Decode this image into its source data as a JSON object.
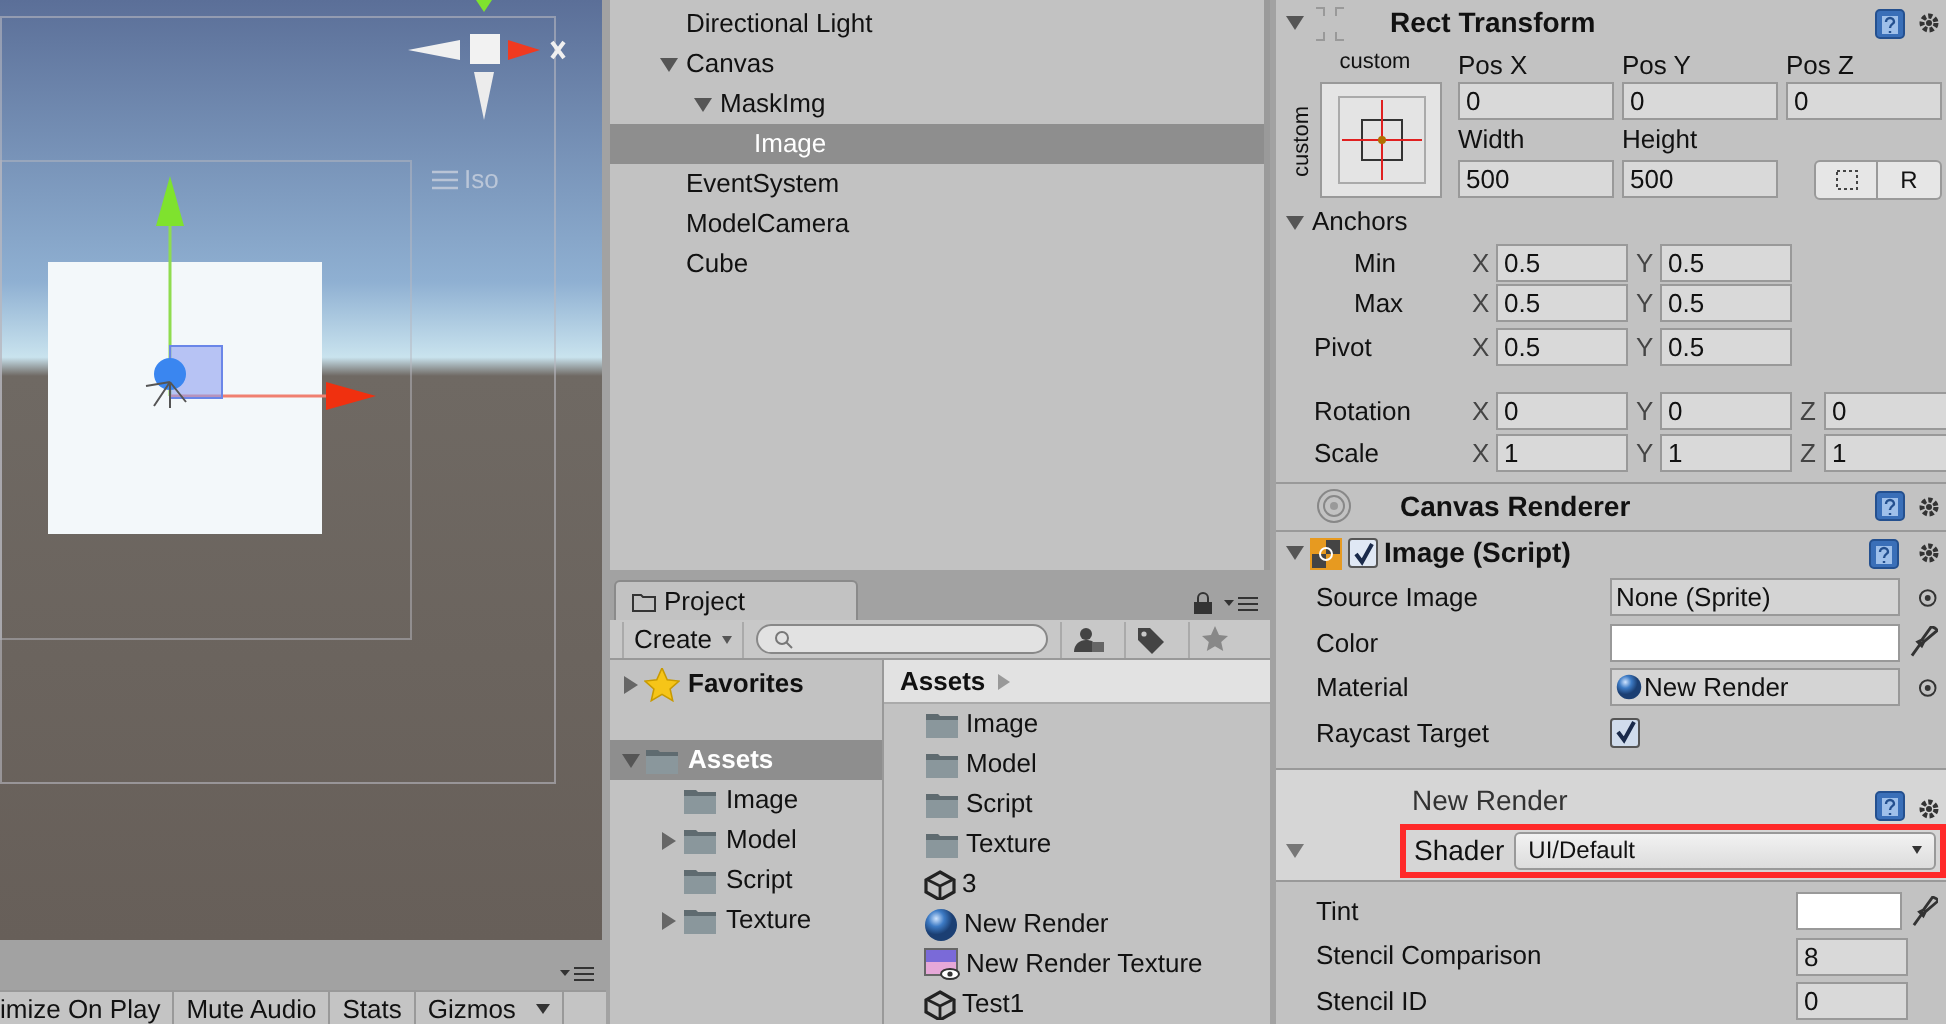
{
  "scene": {
    "view_mode": "Iso",
    "toolbar": [
      "imize On Play",
      "Mute Audio",
      "Stats",
      "Gizmos"
    ]
  },
  "hierarchy": {
    "items": [
      {
        "label": "Directional Light",
        "selected": false
      },
      {
        "label": "Canvas",
        "selected": false,
        "expanded": true,
        "children": [
          {
            "label": "MaskImg",
            "selected": false,
            "expanded": true,
            "children": [
              {
                "label": "Image",
                "selected": true
              }
            ]
          }
        ]
      },
      {
        "label": "EventSystem",
        "selected": false
      },
      {
        "label": "ModelCamera",
        "selected": false
      },
      {
        "label": "Cube",
        "selected": false
      }
    ]
  },
  "project": {
    "tab": "Project",
    "create": "Create",
    "tree": [
      {
        "label": "Favorites",
        "kind": "favorites",
        "selected": false,
        "expanded": false
      },
      {
        "label": "Assets",
        "kind": "folder",
        "selected": true,
        "expanded": true,
        "children": [
          {
            "label": "Image",
            "kind": "folder",
            "selected": false
          },
          {
            "label": "Model",
            "kind": "folder",
            "selected": false,
            "expanded": false
          },
          {
            "label": "Script",
            "kind": "folder",
            "selected": false
          },
          {
            "label": "Texture",
            "kind": "folder",
            "selected": false,
            "expanded": false
          }
        ]
      }
    ],
    "breadcrumb": "Assets",
    "assets": [
      {
        "label": "Image",
        "kind": "folder"
      },
      {
        "label": "Model",
        "kind": "folder"
      },
      {
        "label": "Script",
        "kind": "folder"
      },
      {
        "label": "Texture",
        "kind": "folder"
      },
      {
        "label": "3",
        "kind": "scene"
      },
      {
        "label": "New Render",
        "kind": "material"
      },
      {
        "label": "New Render Texture",
        "kind": "render_texture"
      },
      {
        "label": "Test1",
        "kind": "scene"
      }
    ]
  },
  "inspector": {
    "rect_transform": {
      "title": "Rect Transform",
      "preset_top": "custom",
      "preset_side": "custom",
      "pos_labels": [
        "Pos X",
        "Pos Y",
        "Pos Z"
      ],
      "pos_values": [
        "0",
        "0",
        "0"
      ],
      "size_labels": [
        "Width",
        "Height"
      ],
      "size_values": [
        "500",
        "500"
      ],
      "raw_button": "R",
      "anchors_label": "Anchors",
      "anchors_expanded": true,
      "rows": [
        {
          "label": "Min",
          "indent": true,
          "cells": [
            {
              "axis": "X",
              "value": "0.5"
            },
            {
              "axis": "Y",
              "value": "0.5"
            }
          ]
        },
        {
          "label": "Max",
          "indent": true,
          "cells": [
            {
              "axis": "X",
              "value": "0.5"
            },
            {
              "axis": "Y",
              "value": "0.5"
            }
          ]
        },
        {
          "label": "Pivot",
          "indent": false,
          "cells": [
            {
              "axis": "X",
              "value": "0.5"
            },
            {
              "axis": "Y",
              "value": "0.5"
            }
          ]
        },
        {
          "label": "Rotation",
          "indent": false,
          "cells": [
            {
              "axis": "X",
              "value": "0"
            },
            {
              "axis": "Y",
              "value": "0"
            },
            {
              "axis": "Z",
              "value": "0"
            }
          ]
        },
        {
          "label": "Scale",
          "indent": false,
          "cells": [
            {
              "axis": "X",
              "value": "1"
            },
            {
              "axis": "Y",
              "value": "1"
            },
            {
              "axis": "Z",
              "value": "1"
            }
          ]
        }
      ]
    },
    "canvas_renderer": {
      "title": "Canvas Renderer"
    },
    "image_script": {
      "title": "Image (Script)",
      "enabled": true,
      "fields": [
        {
          "label": "Source Image",
          "kind": "object",
          "value": "None (Sprite)"
        },
        {
          "label": "Color",
          "kind": "color",
          "color": "#ffffff"
        },
        {
          "label": "Material",
          "kind": "material",
          "value": "New Render"
        },
        {
          "label": "Raycast Target",
          "kind": "checkbox",
          "checked": true
        }
      ]
    },
    "material": {
      "title": "New Render",
      "shader_label": "Shader",
      "shader": "UI/Default",
      "highlighted": true,
      "fields": [
        {
          "label": "Tint",
          "kind": "color",
          "color": "#ffffff"
        },
        {
          "label": "Stencil Comparison",
          "kind": "number",
          "value": "8"
        },
        {
          "label": "Stencil ID",
          "kind": "number",
          "value": "0"
        }
      ]
    }
  }
}
